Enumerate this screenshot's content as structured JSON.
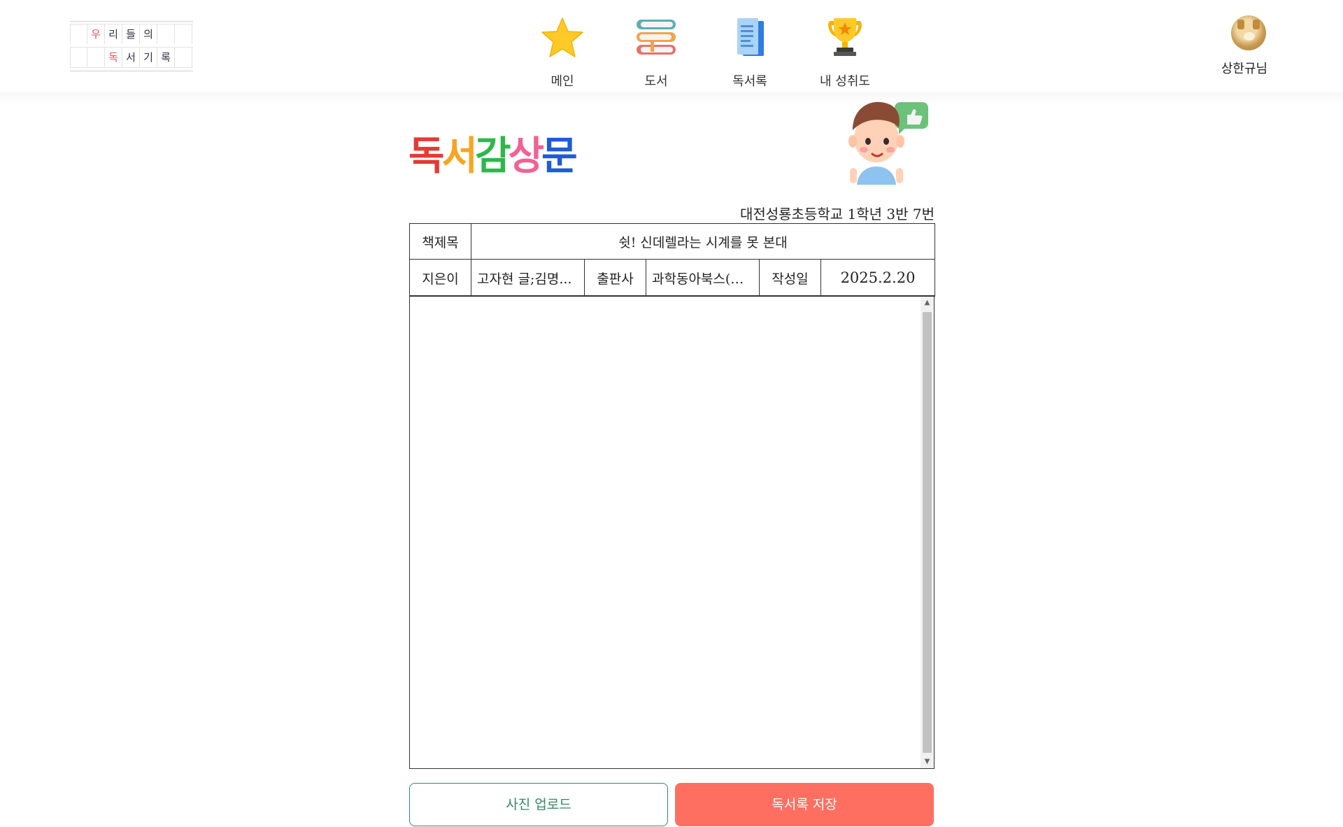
{
  "logo": {
    "row1": [
      "",
      "우",
      "리",
      "들",
      "의",
      "",
      ""
    ],
    "row2": [
      "",
      "",
      "독",
      "서",
      "기",
      "록",
      ""
    ]
  },
  "nav": {
    "items": [
      {
        "label": "메인",
        "icon": "star-icon"
      },
      {
        "label": "도서",
        "icon": "books-icon"
      },
      {
        "label": "독서록",
        "icon": "document-icon"
      },
      {
        "label": "내 성취도",
        "icon": "trophy-icon"
      }
    ]
  },
  "user": {
    "name": "상한규님",
    "avatar": "dog-avatar"
  },
  "page": {
    "title_chars": [
      "독",
      "서",
      "감",
      "상",
      "문"
    ],
    "title_colors": [
      "#e53935",
      "#f5a623",
      "#2eb84b",
      "#f06292",
      "#1e5bd8"
    ],
    "school_info": "대전성룡초등학교 1학년 3반 7번"
  },
  "form": {
    "book_title_label": "책제목",
    "book_title": "쉿! 신데렐라는 시계를 못 본대",
    "author_label": "지은이",
    "author": "고자현 글;김명...",
    "publisher_label": "출판사",
    "publisher": "과학동아북스(동...",
    "date_label": "작성일",
    "date": "2025.2.20",
    "essay": ""
  },
  "buttons": {
    "upload": "사진 업로드",
    "save": "독서록 저장"
  },
  "colors": {
    "upload_border": "#2e8b63",
    "save_bg": "#ff6f61"
  }
}
